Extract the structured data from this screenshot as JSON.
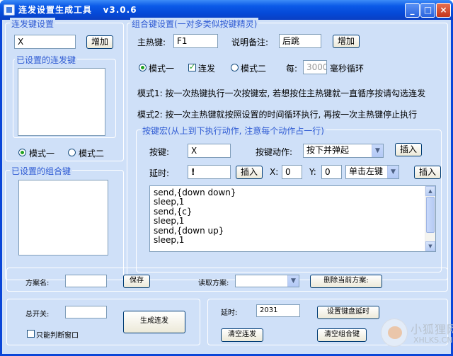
{
  "window": {
    "title": "连发设置生成工具",
    "version": "v3.0.6",
    "minimize_glyph": "_",
    "maximize_glyph": "□",
    "close_glyph": "×"
  },
  "repeat_panel": {
    "title": "连发键设置",
    "key_value": "X",
    "add_label": "增加",
    "list_title": "已设置的连发键",
    "mode1_label": "模式一",
    "mode2_label": "模式二",
    "selected_mode": "mode1"
  },
  "combo_list_panel": {
    "title": "已设置的组合键"
  },
  "combo_panel": {
    "title": "组合键设置(一对多类似按键精灵)",
    "hotkey_label": "主热键:",
    "hotkey_value": "F1",
    "remark_label": "说明备注:",
    "remark_value": "后跳",
    "add_label": "增加",
    "mode1_label": "模式一",
    "repeat_label": "连发",
    "repeat_checked": true,
    "mode2_label": "模式二",
    "interval_label": "每:",
    "interval_value": "3000",
    "interval_unit": "毫秒循环",
    "mode1_desc": "模式1: 按一次热键执行一次按键宏, 若想按住主热键就一直循序按请勾选连发",
    "mode2_desc": "模式2: 按一次主热键就按照设置的时间循环执行, 再按一次主热键停止执行"
  },
  "macro_panel": {
    "title": "按键宏(从上到下执行动作, 注意每个动作占一行)",
    "key_label": "按键:",
    "key_value": "X",
    "action_label": "按键动作:",
    "action_value": "按下并弹起",
    "insert_label": "插入",
    "delay_label": "延时:",
    "delay_value": "!",
    "x_label": "X:",
    "x_value": "0",
    "y_label": "Y:",
    "y_value": "0",
    "mouse_value": "单击左键",
    "script_lines": [
      "send,{down down}",
      "sleep,1",
      "send,{c}",
      "sleep,1",
      "send,{down up}",
      "sleep,1"
    ]
  },
  "scheme_bar": {
    "name_label": "方案名:",
    "name_value": "",
    "save_label": "保存",
    "read_label": "读取方案:",
    "read_value": "",
    "delete_label": "删除当前方案:"
  },
  "bottom_left": {
    "master_label": "总开关:",
    "master_value": "",
    "only_window_label": "只能判断窗口",
    "only_window_checked": false,
    "generate_label": "生成连发"
  },
  "bottom_right": {
    "delay_label": "延时:",
    "delay_value": "2031",
    "set_delay_label": "设置键盘延时",
    "clear_repeat_label": "清空连发",
    "clear_combo_label": "清空组合键"
  },
  "watermark": {
    "cn": "小狐狸网",
    "en": "XHLKS.CN"
  },
  "icons": {
    "app": "app-icon",
    "dropdown": "chevron-down-icon",
    "scroll_up": "scroll-up-icon",
    "scroll_down": "scroll-down-icon"
  }
}
